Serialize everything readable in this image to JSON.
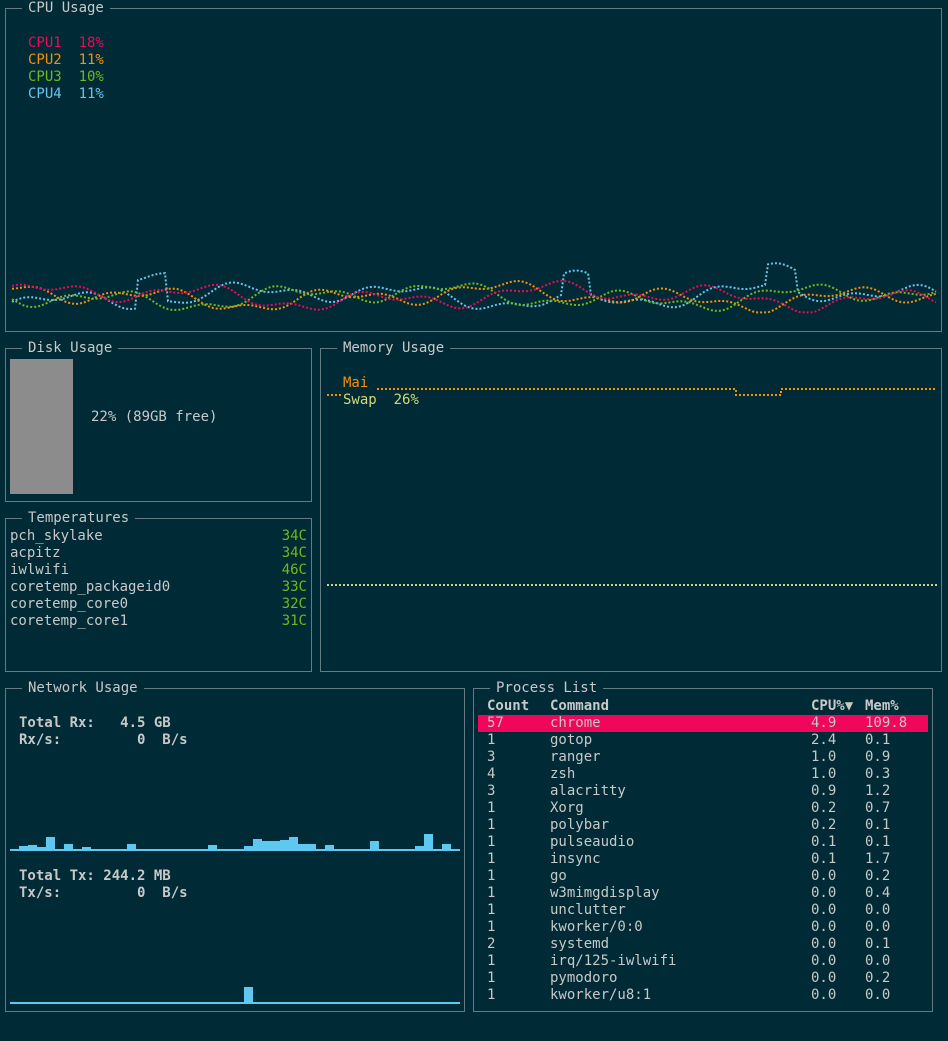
{
  "colors": {
    "cpu1": "#f0065a",
    "cpu2": "#f68e08",
    "cpu3": "#70b81b",
    "cpu4": "#68c4ea",
    "main_mem": "#f68e08",
    "swap_mem": "#d3d77a",
    "temp": "#70b81b",
    "disk_bar": "#8c8c8c",
    "net_bar": "#5ec8f0",
    "selected_row": "#f0065a"
  },
  "cpu": {
    "title": "CPU Usage",
    "legend": [
      {
        "name": "CPU1",
        "value": "18%"
      },
      {
        "name": "CPU2",
        "value": "11%"
      },
      {
        "name": "CPU3",
        "value": "10%"
      },
      {
        "name": "CPU4",
        "value": "11%"
      }
    ]
  },
  "disk": {
    "title": "Disk Usage",
    "label": "22% (89GB free)",
    "used_fraction": 0.22
  },
  "memory": {
    "title": "Memory Usage",
    "main_label": "Mai",
    "swap_label": "Swap",
    "swap_value": "26%"
  },
  "temperatures": {
    "title": "Temperatures",
    "rows": [
      {
        "name": "pch_skylake",
        "value": "34C"
      },
      {
        "name": "acpitz",
        "value": "34C"
      },
      {
        "name": "iwlwifi",
        "value": "46C"
      },
      {
        "name": "coretemp_packageid0",
        "value": "33C"
      },
      {
        "name": "coretemp_core0",
        "value": "32C"
      },
      {
        "name": "coretemp_core1",
        "value": "31C"
      }
    ]
  },
  "network": {
    "title": "Network Usage",
    "rx_total_label": "Total Rx:",
    "rx_total_value": "4.5 GB",
    "rx_rate_label": "Rx/s:",
    "rx_rate_value": "0  B/s",
    "tx_total_label": "Total Tx:",
    "tx_total_value": "244.2 MB",
    "tx_rate_label": "Tx/s:",
    "tx_rate_value": "0  B/s"
  },
  "process": {
    "title": "Process List",
    "headers": {
      "count": "Count",
      "command": "Command",
      "cpu": "CPU%▼",
      "mem": "Mem%"
    },
    "rows": [
      {
        "count": "57",
        "command": "chrome",
        "cpu": "4.9",
        "mem": "109.8"
      },
      {
        "count": "1",
        "command": "gotop",
        "cpu": "2.4",
        "mem": "0.1"
      },
      {
        "count": "3",
        "command": "ranger",
        "cpu": "1.0",
        "mem": "0.9"
      },
      {
        "count": "4",
        "command": "zsh",
        "cpu": "1.0",
        "mem": "0.3"
      },
      {
        "count": "3",
        "command": "alacritty",
        "cpu": "0.9",
        "mem": "1.2"
      },
      {
        "count": "1",
        "command": "Xorg",
        "cpu": "0.2",
        "mem": "0.7"
      },
      {
        "count": "1",
        "command": "polybar",
        "cpu": "0.2",
        "mem": "0.1"
      },
      {
        "count": "1",
        "command": "pulseaudio",
        "cpu": "0.1",
        "mem": "0.1"
      },
      {
        "count": "1",
        "command": "insync",
        "cpu": "0.1",
        "mem": "1.7"
      },
      {
        "count": "1",
        "command": "go",
        "cpu": "0.0",
        "mem": "0.2"
      },
      {
        "count": "1",
        "command": "w3mimgdisplay",
        "cpu": "0.0",
        "mem": "0.4"
      },
      {
        "count": "1",
        "command": "unclutter",
        "cpu": "0.0",
        "mem": "0.0"
      },
      {
        "count": "1",
        "command": "kworker/0:0",
        "cpu": "0.0",
        "mem": "0.0"
      },
      {
        "count": "2",
        "command": "systemd",
        "cpu": "0.0",
        "mem": "0.1"
      },
      {
        "count": "1",
        "command": "irq/125-iwlwifi",
        "cpu": "0.0",
        "mem": "0.0"
      },
      {
        "count": "1",
        "command": "pymodoro",
        "cpu": "0.0",
        "mem": "0.2"
      },
      {
        "count": "1",
        "command": "kworker/u8:1",
        "cpu": "0.0",
        "mem": "0.0"
      }
    ]
  }
}
